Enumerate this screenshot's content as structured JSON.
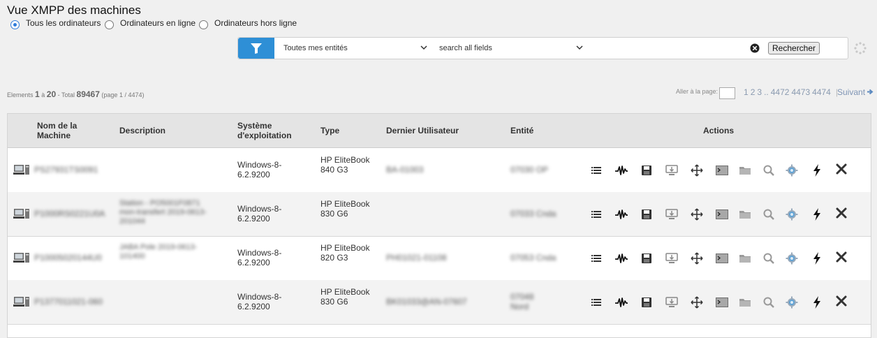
{
  "page": {
    "title": "Vue XMPP des machines"
  },
  "radios": [
    {
      "label": "Tous les ordinateurs",
      "checked": true
    },
    {
      "label": "Ordinateurs en ligne",
      "checked": false
    },
    {
      "label": "Ordinateurs hors ligne",
      "checked": false
    }
  ],
  "search": {
    "entity_select": "Toutes mes entités",
    "field_select": "search all fields",
    "query_value": "",
    "button_label": "Rechercher"
  },
  "pagination": {
    "elements_label": "Elements",
    "from": "1",
    "to_label": "à",
    "to": "20",
    "total_label": "- Total",
    "total": "89467",
    "page_info": "(page 1 / 4474)",
    "goto_label": "Aller à la page:",
    "pages": [
      "1",
      "2",
      "3",
      "..",
      "4472",
      "4473",
      "4474"
    ],
    "separator": "|",
    "next_label": "Suivant"
  },
  "table": {
    "headers": {
      "name": "Nom de la Machine",
      "description": "Description",
      "os": "Système d'exploitation",
      "type": "Type",
      "last_user": "Dernier Utilisateur",
      "entity": "Entité",
      "actions": "Actions"
    },
    "rows": [
      {
        "name": "PS27931TS0091",
        "description": "",
        "os": "Windows-8-6.2.9200",
        "type": "HP EliteBook 840 G3",
        "last_user": "BA-01003",
        "entity": "07030 OP"
      },
      {
        "name": "P1000RS0221U0A",
        "description": "Station - PO5001F0871 mon-transfert 2019-0613-201044",
        "os": "Windows-8-6.2.9200",
        "type": "HP EliteBook 830 G6",
        "last_user": "",
        "entity": "07033 Cnda"
      },
      {
        "name": "P10005020144U0",
        "description": "JABA Pole 2019-0613-101400",
        "os": "Windows-8-6.2.9200",
        "type": "HP EliteBook 820 G3",
        "last_user": "PH01021-01108",
        "entity": "07053 Cnda"
      },
      {
        "name": "P1377011021-060",
        "description": "",
        "os": "Windows-8-6.2.9200",
        "type": "HP EliteBook 830 G6",
        "last_user": "BK01033@AN-07607",
        "entity": "07048 Nord"
      }
    ]
  },
  "actions": [
    "list-icon",
    "pulse-icon",
    "save-icon",
    "remote-desktop-icon",
    "move-icon",
    "terminal-icon",
    "folder-icon",
    "inventory-search-icon",
    "settings-gear-icon",
    "power-icon",
    "delete-icon"
  ],
  "colors": {
    "accent": "#2e8fd6",
    "link": "#7f95b5"
  }
}
